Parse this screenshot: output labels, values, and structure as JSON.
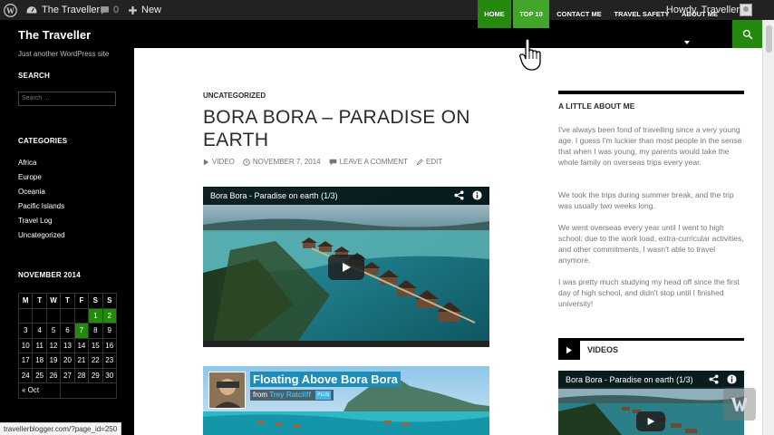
{
  "admin_bar": {
    "site_name": "The Traveller",
    "comment_count": "0",
    "new_label": "New",
    "howdy": "Howdy, Traveller"
  },
  "sidebar": {
    "site_title": "The Traveller",
    "tagline": "Just another WordPress site",
    "search_heading": "SEARCH",
    "search_placeholder": "Search …",
    "categories_heading": "CATEGORIES",
    "categories": [
      "Africa",
      "Europe",
      "Oceania",
      "Pacific Islands",
      "Travel Log",
      "Uncategorized"
    ],
    "calendar": {
      "heading": "NOVEMBER 2014",
      "weekdays": [
        "M",
        "T",
        "W",
        "T",
        "F",
        "S",
        "S"
      ],
      "weeks": [
        [
          "",
          "",
          "",
          "",
          "",
          "1",
          "2"
        ],
        [
          "3",
          "4",
          "5",
          "6",
          "7",
          "8",
          "9"
        ],
        [
          "10",
          "11",
          "12",
          "13",
          "14",
          "15",
          "16"
        ],
        [
          "17",
          "18",
          "19",
          "20",
          "21",
          "22",
          "23"
        ],
        [
          "24",
          "25",
          "26",
          "27",
          "28",
          "29",
          "30"
        ]
      ],
      "highlighted_days": [
        "1",
        "2",
        "7"
      ],
      "prev_link": "« Oct"
    }
  },
  "nav": {
    "items": [
      "HOME",
      "TOP 10",
      "CONTACT ME",
      "TRAVEL SAFETY",
      "ABOUT ME"
    ],
    "active": "HOME",
    "hovered": "TOP 10"
  },
  "post": {
    "category": "UNCATEGORIZED",
    "title": "BORA BORA – PARADISE ON EARTH",
    "meta": {
      "format": "VIDEO",
      "date": "NOVEMBER 7, 2014",
      "comment": "LEAVE A COMMENT",
      "edit": "EDIT"
    },
    "video1_title": "Bora Bora - Paradise on earth (1/3)",
    "video2_title": "Floating Above Bora Bora",
    "video2_from_label": "from",
    "video2_author": "Trey Ratcliff",
    "video2_badge": "PLUS"
  },
  "right": {
    "about_heading": "A LITTLE ABOUT ME",
    "paragraphs": [
      "I've always been fond of travelling since a very young age. I guess I'm luckier than most people in the sense that when I was young, my parents would take the whole family on overseas trips every year.",
      "We took the trips during summer break, and the trip was usually two weeks long.",
      "We went overseas every year until I went to high school; due to the work load, extra-curricular activities, and other commitments, I wasn't able to travel anymore.",
      "I was pretty much studying my head off since the first day of high school, and didn't stop until I finished university!"
    ],
    "videos_heading": "VIDEOS",
    "video3_title": "Bora Bora - Paradise on earth (1/3)"
  },
  "status_url": "travellerblogger.com/?page_id=250",
  "colors": {
    "accent": "#24890d",
    "accent_hover": "#41a62a",
    "sidebar_bg": "#000000"
  }
}
